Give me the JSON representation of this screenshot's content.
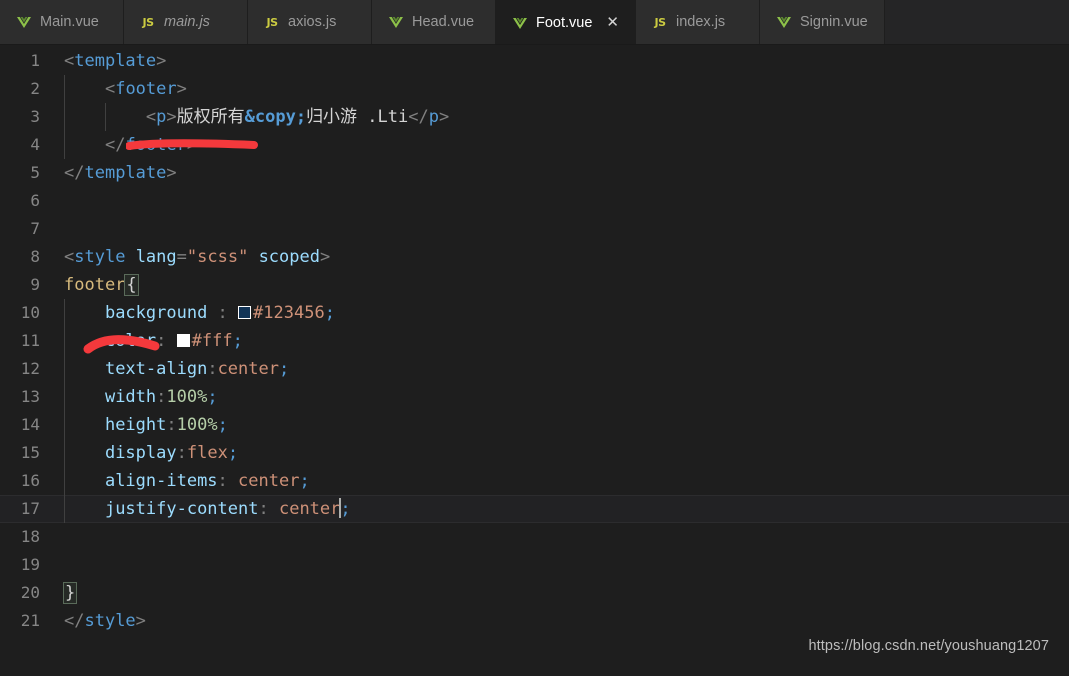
{
  "tabs": [
    {
      "label": "Main.vue",
      "icon": "vue-icon",
      "active": false,
      "preview": false,
      "closable": false
    },
    {
      "label": "main.js",
      "icon": "js-icon",
      "active": false,
      "preview": true,
      "closable": false
    },
    {
      "label": "axios.js",
      "icon": "js-icon",
      "active": false,
      "preview": false,
      "closable": false
    },
    {
      "label": "Head.vue",
      "icon": "vue-icon",
      "active": false,
      "preview": false,
      "closable": false
    },
    {
      "label": "Foot.vue",
      "icon": "vue-icon",
      "active": true,
      "preview": false,
      "closable": true,
      "close_label": "✕"
    },
    {
      "label": "index.js",
      "icon": "js-icon",
      "active": false,
      "preview": false,
      "closable": false
    },
    {
      "label": "Signin.vue",
      "icon": "vue-icon",
      "active": false,
      "preview": false,
      "closable": false
    }
  ],
  "editor": {
    "language": "vue",
    "cursor_line": 17,
    "line_numbers": [
      "1",
      "2",
      "3",
      "4",
      "5",
      "6",
      "7",
      "8",
      "9",
      "10",
      "11",
      "12",
      "13",
      "14",
      "15",
      "16",
      "17",
      "18",
      "19",
      "20",
      "21"
    ],
    "lines": {
      "l1": {
        "text": "<template>"
      },
      "l2": {
        "text": "    <footer>"
      },
      "l3": {
        "text": "        <p>版权所有&copy;归小游 .Lti</p>",
        "cjk_1": "版权所有",
        "entity": "&copy;",
        "cjk_2": "归小游",
        "suffix": " .Lti"
      },
      "l4": {
        "text": "    </footer>"
      },
      "l5": {
        "text": "</template>"
      },
      "l6": {
        "text": ""
      },
      "l7": {
        "text": ""
      },
      "l8": {
        "text": "<style lang=\"scss\" scoped>",
        "attr": "lang",
        "attr_value": "\"scss\"",
        "attr2": "scoped"
      },
      "l9": {
        "text": "footer{",
        "selector": "footer",
        "brace": "{"
      },
      "l10": {
        "text": "    background : #123456;",
        "prop": "background ",
        "value": "#123456",
        "swatch_color": "#123456"
      },
      "l11": {
        "text": "    color: #fff;",
        "prop": "color",
        "value": "#fff",
        "swatch_color": "#ffffff"
      },
      "l12": {
        "text": "    text-align:center;",
        "prop": "text-align",
        "value": "center"
      },
      "l13": {
        "text": "    width:100%;",
        "prop": "width",
        "value": "100%"
      },
      "l14": {
        "text": "    height:100%;",
        "prop": "height",
        "value": "100%"
      },
      "l15": {
        "text": "    display:flex;",
        "prop": "display",
        "value": "flex"
      },
      "l16": {
        "text": "    align-items: center;",
        "prop": "align-items",
        "value": "center"
      },
      "l17": {
        "text": "    justify-content: center;",
        "prop": "justify-content",
        "value": "center"
      },
      "l18": {
        "text": ""
      },
      "l19": {
        "text": ""
      },
      "l20": {
        "text": "}",
        "brace": "}"
      },
      "l21": {
        "text": "</style>"
      }
    }
  },
  "annotations": [
    {
      "name": "red-underline-line3",
      "color": "#f4393c",
      "shape": "straight-stroke"
    },
    {
      "name": "red-stroke-line10",
      "color": "#f4393c",
      "shape": "curved-stroke"
    }
  ],
  "watermark": {
    "text": "https://blog.csdn.net/youshuang1207"
  },
  "colors": {
    "editor_background": "#1e1e1e",
    "tabbar_background": "#252526",
    "inactive_tab_background": "#2d2d2d",
    "active_tab_background": "#1e1e1e",
    "gutter_text": "#868686",
    "tag_blue": "#569cd6",
    "string_orange": "#ce9178",
    "property_light_blue": "#9cdcfe",
    "number_green": "#b5cea8",
    "selector_gold": "#d7ba7d",
    "annotation_red": "#f4393c",
    "vue_green": "#8dc149",
    "js_yellow": "#cbcb41"
  }
}
